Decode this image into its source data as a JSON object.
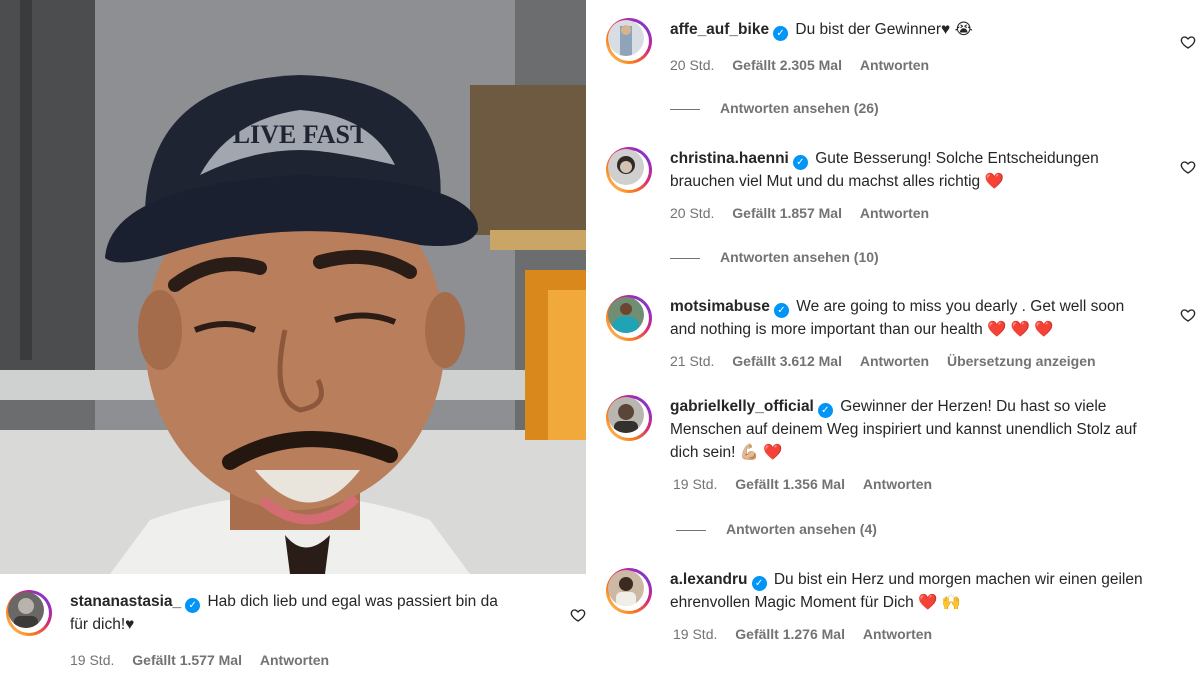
{
  "video_comment": {
    "username": "stananastasia_",
    "text_line1": "Hab dich lieb und egal was passiert bin da",
    "text_line2": "für dich!♥",
    "time": "19 Std.",
    "likes": "Gefällt 1.577 Mal",
    "reply": "Antworten"
  },
  "comments": [
    {
      "username": "affe_auf_bike",
      "text": "Du bist der Gewinner♥",
      "emoji": "😭",
      "time": "20 Std.",
      "likes": "Gefällt 2.305 Mal",
      "reply": "Antworten",
      "view_replies": "Antworten ansehen (26)"
    },
    {
      "username": "christina.haenni",
      "text": "Gute Besserung! Solche Entscheidungen brauchen viel Mut und du machst alles richtig",
      "emoji": "❤️",
      "time": "20 Std.",
      "likes": "Gefällt 1.857 Mal",
      "reply": "Antworten",
      "view_replies": "Antworten ansehen (10)"
    },
    {
      "username": "motsimabuse",
      "text": "We are going to miss you dearly . Get well soon and nothing is more important than our health",
      "emoji": "❤️ ❤️ ❤️",
      "time": "21 Std.",
      "likes": "Gefällt 3.612 Mal",
      "reply": "Antworten",
      "translate": "Übersetzung anzeigen"
    },
    {
      "username": "gabrielkelly_official",
      "text": "Gewinner der Herzen! Du hast so viele Menschen auf deinem Weg inspiriert und kannst unendlich Stolz auf dich sein!",
      "emoji": "💪🏼 ❤️",
      "time": "19 Std.",
      "likes": "Gefällt 1.356 Mal",
      "reply": "Antworten",
      "view_replies": "Antworten ansehen (4)"
    },
    {
      "username": "a.lexandru",
      "text": "Du bist ein Herz und morgen machen wir einen geilen ehrenvollen Magic Moment für Dich",
      "emoji": "❤️  🙌",
      "time": "19 Std.",
      "likes": "Gefällt 1.276 Mal",
      "reply": "Antworten"
    }
  ],
  "video": {
    "cap_text": "LIVE FAST"
  },
  "colors": {
    "verified": "#0095f6",
    "meta": "#737373",
    "heart": "#e0245e"
  }
}
